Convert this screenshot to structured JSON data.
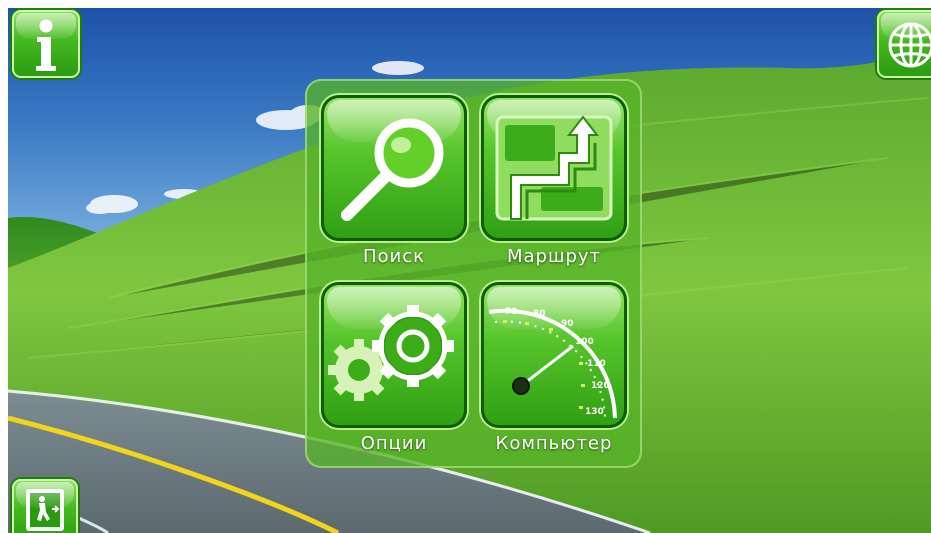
{
  "menu": {
    "items": [
      {
        "label": "Поиск",
        "icon": "magnifier-icon"
      },
      {
        "label": "Маршрут",
        "icon": "route-icon"
      },
      {
        "label": "Опции",
        "icon": "gears-icon"
      },
      {
        "label": "Компьютер",
        "icon": "speedometer-icon"
      }
    ]
  },
  "speedometer": {
    "ticks": [
      "70",
      "80",
      "90",
      "100",
      "110",
      "120",
      "130"
    ]
  },
  "corner_buttons": {
    "info": {
      "icon": "info-icon"
    },
    "globe": {
      "icon": "globe-icon"
    },
    "exit": {
      "icon": "exit-walker-icon"
    }
  },
  "colors": {
    "accent_green": "#3aad16",
    "dark_green": "#0d5e05",
    "sky_blue": "#2f6fc0"
  }
}
